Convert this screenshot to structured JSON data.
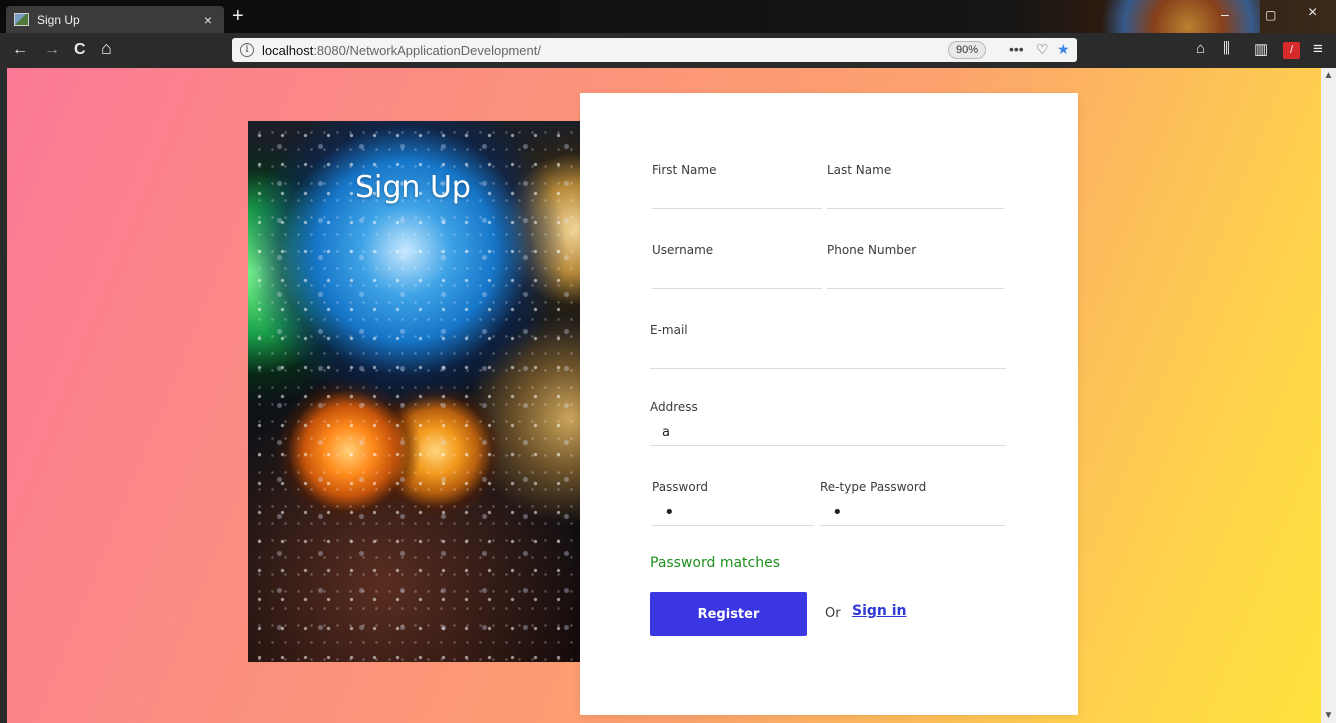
{
  "browser": {
    "tab_title": "Sign Up",
    "tab_close": "×",
    "new_tab": "+",
    "nav": {
      "back": "←",
      "forward": "→",
      "reload": "C",
      "home": "⌂"
    },
    "url_host": "localhost",
    "url_rest": ":8080/NetworkApplicationDevelopment/",
    "url_info": "i",
    "zoom": "90%",
    "page_actions": "•••",
    "pocket": "♡",
    "star": "★",
    "window": {
      "minimize": "–",
      "restore": "▢",
      "close": "×"
    },
    "toolbar": {
      "library": "⫼",
      "sidebar": "▥",
      "menu": "≡",
      "downloads": "⌂"
    }
  },
  "hero": {
    "title": "Sign Up"
  },
  "form": {
    "first_name": {
      "label": "First Name",
      "value": ""
    },
    "last_name": {
      "label": "Last Name",
      "value": ""
    },
    "username": {
      "label": "Username",
      "value": ""
    },
    "phone": {
      "label": "Phone Number",
      "value": ""
    },
    "email": {
      "label": "E-mail",
      "value": ""
    },
    "address": {
      "label": "Address",
      "value": "a"
    },
    "password": {
      "label": "Password",
      "value": "•"
    },
    "retype": {
      "label": "Re-type Password",
      "value": "•"
    },
    "match_message": "Password matches",
    "register_label": "Register",
    "or_text": "Or",
    "signin_label": "Sign in"
  },
  "colors": {
    "accent": "#3a36e1",
    "link": "#2f3ad8",
    "success": "#1d8f1d"
  }
}
